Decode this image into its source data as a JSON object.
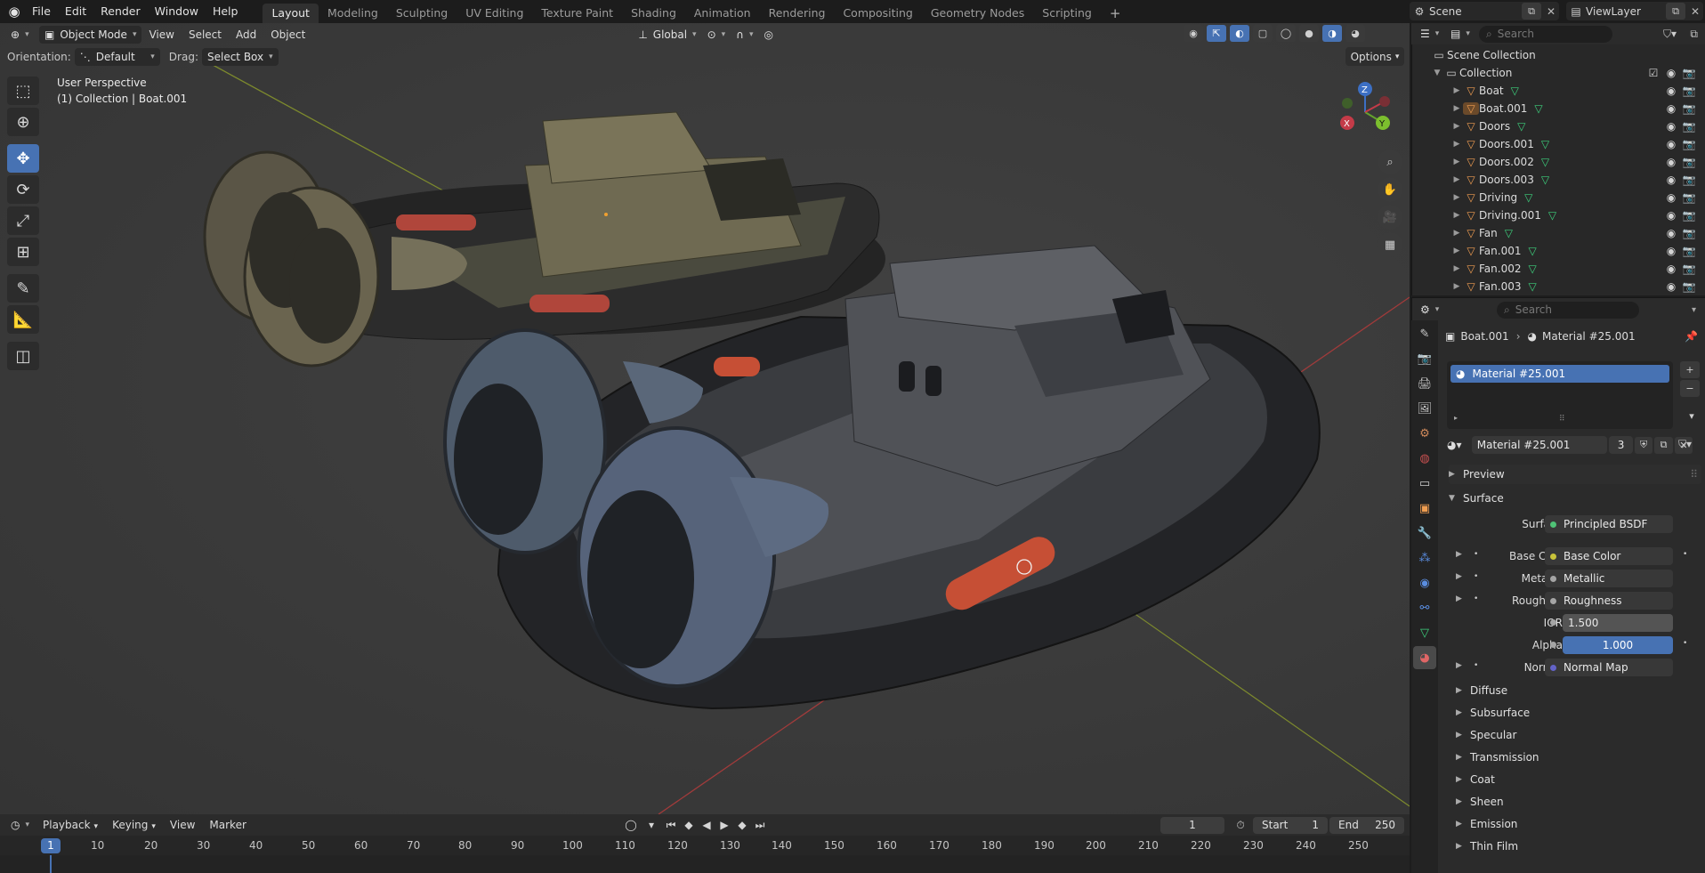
{
  "colors": {
    "accent": "#4772b3",
    "object_orange": "#ef9d51",
    "mesh_green": "#3dd07c",
    "shader_green": "#4fc276",
    "color_yellow": "#c9c33a",
    "float_gray": "#a5a5a5",
    "vector_purple": "#6363c7"
  },
  "menu": {
    "logo_icon": "blender-logo-icon",
    "items": [
      "File",
      "Edit",
      "Render",
      "Window",
      "Help"
    ]
  },
  "workspaces": [
    "Layout",
    "Modeling",
    "Sculpting",
    "UV Editing",
    "Texture Paint",
    "Shading",
    "Animation",
    "Rendering",
    "Compositing",
    "Geometry Nodes",
    "Scripting",
    "+"
  ],
  "scene": {
    "name": "Scene",
    "view_layer": "ViewLayer"
  },
  "viewport": {
    "mode": "Object Mode",
    "menus": [
      "View",
      "Select",
      "Add",
      "Object"
    ],
    "transform_orientation": "Global",
    "orientation_label": "Orientation:",
    "orientation_value": "Default",
    "drag_label": "Drag:",
    "drag_value": "Select Box",
    "options": "Options",
    "info_line1": "User Perspective",
    "info_line2": "(1) Collection | Boat.001",
    "gizmo": {
      "z": "Z",
      "y": "Y",
      "x": "X"
    }
  },
  "timeline": {
    "menus": [
      "Playback",
      "Keying",
      "View",
      "Marker"
    ],
    "current_frame": "1",
    "start_label": "Start",
    "start": "1",
    "end_label": "End",
    "end": "250",
    "ticks": [
      "1",
      "10",
      "20",
      "30",
      "40",
      "50",
      "60",
      "70",
      "80",
      "90",
      "100",
      "110",
      "120",
      "130",
      "140",
      "150",
      "160",
      "170",
      "180",
      "190",
      "200",
      "210",
      "220",
      "230",
      "240",
      "250"
    ]
  },
  "outliner": {
    "search_placeholder": "Search",
    "scene_collection": "Scene Collection",
    "collection": "Collection",
    "items": [
      "Boat",
      "Boat.001",
      "Doors",
      "Doors.001",
      "Doors.002",
      "Doors.003",
      "Driving",
      "Driving.001",
      "Fan",
      "Fan.001",
      "Fan.002",
      "Fan.003"
    ]
  },
  "properties": {
    "search_placeholder": "Search",
    "breadcrumb_object": "Boat.001",
    "breadcrumb_material": "Material #25.001",
    "slot_name": "Material #25.001",
    "material_name": "Material #25.001",
    "users": "3",
    "sections": {
      "preview": "Preview",
      "surface": "Surface"
    },
    "surface_label": "Surface",
    "surface_value": "Principled BSDF",
    "inputs": [
      {
        "label": "Base Co...",
        "value": "Base Color"
      },
      {
        "label": "Metallic",
        "value": "Metallic"
      },
      {
        "label": "Roughn...",
        "value": "Roughness"
      },
      {
        "label": "IOR",
        "value": "1.500"
      },
      {
        "label": "Alpha",
        "value": "1.000"
      },
      {
        "label": "Normal",
        "value": "Normal Map"
      }
    ],
    "subpanels": [
      "Diffuse",
      "Subsurface",
      "Specular",
      "Transmission",
      "Coat",
      "Sheen",
      "Emission",
      "Thin Film"
    ]
  }
}
